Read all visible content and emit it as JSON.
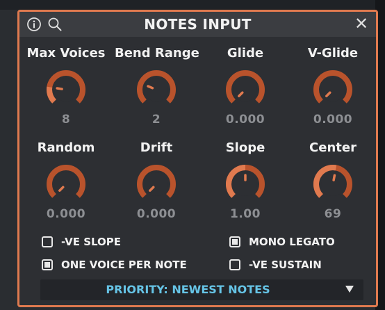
{
  "window": {
    "title": "NOTES INPUT",
    "accent_color": "#e07a4f",
    "knob_color": "#b9532c",
    "icons": [
      "info-icon",
      "search-icon",
      "close-icon"
    ],
    "close_glyph": "✕"
  },
  "knobs": [
    {
      "label": "Max Voices",
      "value": "8",
      "level": 0.2,
      "arc_level": 0.2
    },
    {
      "label": "Bend Range",
      "value": "2",
      "level": 0.25,
      "arc_level": 0.0
    },
    {
      "label": "Glide",
      "value": "0.000",
      "level": 0.0,
      "arc_level": 0.0
    },
    {
      "label": "V-Glide",
      "value": "0.000",
      "level": 0.0,
      "arc_level": 0.0
    },
    {
      "label": "Random",
      "value": "0.000",
      "level": 0.0,
      "arc_level": 0.0
    },
    {
      "label": "Drift",
      "value": "0.000",
      "level": 0.0,
      "arc_level": 0.0
    },
    {
      "label": "Slope",
      "value": "1.00",
      "level": 0.5,
      "arc_level": 0.5
    },
    {
      "label": "Center",
      "value": "69",
      "level": 0.54,
      "arc_level": 0.54
    }
  ],
  "options": [
    {
      "label": "-VE SLOPE",
      "checked": false
    },
    {
      "label": "MONO LEGATO",
      "checked": true
    },
    {
      "label": "ONE VOICE PER NOTE",
      "checked": true
    },
    {
      "label": "-VE SUSTAIN",
      "checked": false
    }
  ],
  "priority": {
    "label": "PRIORITY: NEWEST NOTES"
  }
}
